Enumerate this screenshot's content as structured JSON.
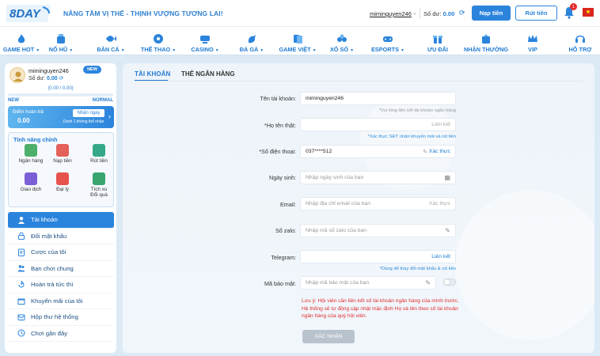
{
  "header": {
    "logo_text": "8DAY",
    "slogan": "NÂNG TẦM VỊ THẾ - THỊNH VƯỢNG TƯƠNG LAI!",
    "username": "miminguyen246",
    "balance_label": "Số dư:",
    "balance_value": "0.00",
    "deposit_label": "Nạp tiền",
    "withdraw_label": "Rút tiền",
    "notification_count": "1",
    "accent_color": "#2b84dc"
  },
  "nav": {
    "items": [
      {
        "label": "GAME HOT",
        "icon": "flame-icon",
        "dropdown": true
      },
      {
        "label": "NỔ HŨ",
        "icon": "slot-jar-icon",
        "dropdown": true
      },
      {
        "label": "BẮN CÁ",
        "icon": "fish-icon",
        "dropdown": true
      },
      {
        "label": "THỂ THAO",
        "icon": "soccer-ball-icon",
        "dropdown": true
      },
      {
        "label": "CASINO",
        "icon": "casino-table-icon",
        "dropdown": true
      },
      {
        "label": "ĐÁ GÀ",
        "icon": "rooster-icon",
        "dropdown": true
      },
      {
        "label": "GAME VIỆT",
        "icon": "cards-icon",
        "dropdown": true
      },
      {
        "label": "XỔ SỐ",
        "icon": "lottery-balls-icon",
        "dropdown": true
      },
      {
        "label": "ESPORTS",
        "icon": "gamepad-icon",
        "dropdown": true
      },
      {
        "label": "ƯU ĐÃI",
        "icon": "gift-icon",
        "dropdown": false
      },
      {
        "label": "NHẬN THƯỞNG",
        "icon": "reward-icon",
        "dropdown": false
      },
      {
        "label": "VIP",
        "icon": "crown-icon",
        "dropdown": false
      },
      {
        "label": "HỖ TRỢ",
        "icon": "support-icon",
        "dropdown": false
      }
    ]
  },
  "sidebar": {
    "user": {
      "name": "miminguyen246",
      "badge": "NEW",
      "balance_label": "Số dư:",
      "balance_value": "0.00",
      "progress_text": "(0.00 / 0.00)",
      "progress_fraction": 0,
      "level_current": "NEW",
      "level_next": "NORMAL"
    },
    "refund": {
      "title": "Điểm hoàn trả",
      "value": "0.00",
      "button_label": "Nhận ngay",
      "note": "Dưới 1 không thể nhận"
    },
    "features": {
      "title": "Tính năng chính",
      "items": [
        {
          "label": "Ngân hàng",
          "icon": "bank-icon",
          "color": "#4caf6a"
        },
        {
          "label": "Nạp tiền",
          "icon": "deposit-icon",
          "color": "#e4615a"
        },
        {
          "label": "Rút tiền",
          "icon": "withdraw-icon",
          "color": "#35a88a"
        },
        {
          "label": "Giao dịch",
          "icon": "transaction-icon",
          "color": "#7b5fd6"
        },
        {
          "label": "Đại lý",
          "icon": "agent-icon",
          "color": "#e6534d"
        },
        {
          "label": "Tích xu\nĐổi quà",
          "icon": "coin-gift-icon",
          "color": "#39a56f"
        }
      ]
    },
    "menu": [
      {
        "label": "Tài khoản",
        "icon": "user-icon",
        "active": true
      },
      {
        "label": "Đổi mật khẩu",
        "icon": "lock-icon",
        "active": false
      },
      {
        "label": "Cược của tôi",
        "icon": "bet-slip-icon",
        "active": false
      },
      {
        "label": "Bạn chơi chung",
        "icon": "friends-icon",
        "active": false
      },
      {
        "label": "Hoàn trả tức thì",
        "icon": "instant-refund-icon",
        "active": false
      },
      {
        "label": "Khuyến mãi của tôi",
        "icon": "promotion-icon",
        "active": false
      },
      {
        "label": "Hộp thư hệ thống",
        "icon": "mailbox-icon",
        "active": false
      },
      {
        "label": "Chơi gần đây",
        "icon": "history-icon",
        "active": false
      }
    ]
  },
  "content": {
    "tabs": [
      {
        "label": "TÀI KHOẢN",
        "active": true
      },
      {
        "label": "THẺ NGÂN HÀNG",
        "active": false
      }
    ],
    "fields": {
      "username": {
        "label": "Tên tài khoản:",
        "value": "miminguyen246",
        "hint": "*Vui lòng liên kết tài khoản ngân hàng"
      },
      "fullname": {
        "label": "*Họ tên thật:",
        "value": "",
        "action": "Liên kết",
        "hint": "*Xác thực SĐT nhận khuyến mãi và rút tiền"
      },
      "phone": {
        "label": "*Số điện thoại:",
        "value": "037****512",
        "action": "Xác thực"
      },
      "birthday": {
        "label": "Ngày sinh:",
        "placeholder": "Nhập ngày sinh của bạn"
      },
      "email": {
        "label": "Email:",
        "placeholder": "Nhập địa chỉ email của bạn",
        "action": "Xác thực"
      },
      "zalo": {
        "label": "Số zalo:",
        "placeholder": "Nhập mã số zalo của bạn"
      },
      "telegram": {
        "label": "Telegram:",
        "value": "",
        "action": "Liên kết",
        "hint": "*Dùng để thay đổi mật khẩu & rút tiền"
      },
      "security": {
        "label": "Mã bảo mật:",
        "placeholder": "Nhập mã bảo mật của bạn"
      }
    },
    "note": "Lưu ý: Hội viên cần liên kết số tài khoản ngân hàng của mình trước. Hệ thống sẽ tự động cập nhật mặc định Họ và tên theo số tài khoản ngân hàng của quý hội viên.",
    "confirm_label": "XÁC NHẬN"
  }
}
